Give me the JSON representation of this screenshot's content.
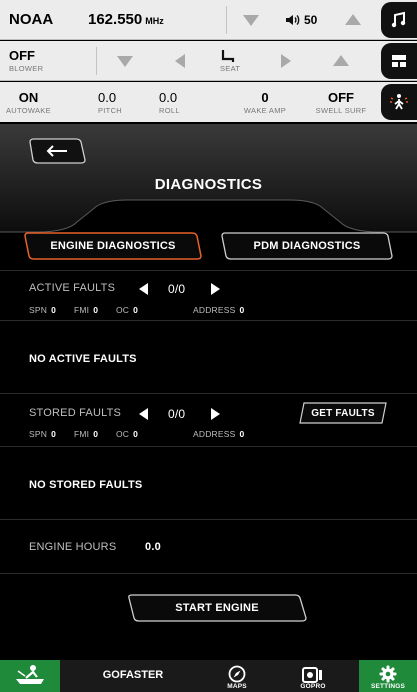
{
  "top_bar": {
    "radio_label": "NOAA",
    "frequency": "162.550",
    "frequency_unit": "MHz",
    "volume_icon": "🔉",
    "volume": "50"
  },
  "blower_row": {
    "blower_value": "OFF",
    "blower_label": "BLOWER",
    "seat_label": "SEAT"
  },
  "status_row": {
    "autowake_value": "ON",
    "autowake_label": "AUTOWAKE",
    "pitch_value": "0.0",
    "pitch_label": "PITCH",
    "roll_value": "0.0",
    "roll_label": "ROLL",
    "wake_amp_value": "0",
    "wake_amp_label": "WAKE AMP",
    "swell_surf_value": "OFF",
    "swell_surf_label": "SWELL SURF"
  },
  "page": {
    "title": "DIAGNOSTICS"
  },
  "tabs": {
    "engine": "ENGINE DIAGNOSTICS",
    "pdm": "PDM DIAGNOSTICS"
  },
  "active_faults": {
    "label": "ACTIVE FAULTS",
    "counter": "0/0",
    "spn_label": "SPN",
    "spn": "0",
    "fmi_label": "FMI",
    "fmi": "0",
    "oc_label": "OC",
    "oc": "0",
    "address_label": "ADDRESS",
    "address": "0",
    "message": "NO ACTIVE FAULTS"
  },
  "stored_faults": {
    "label": "STORED FAULTS",
    "counter": "0/0",
    "get_faults": "GET FAULTS",
    "spn_label": "SPN",
    "spn": "0",
    "fmi_label": "FMI",
    "fmi": "0",
    "oc_label": "OC",
    "oc": "0",
    "address_label": "ADDRESS",
    "address": "0",
    "message": "NO STORED FAULTS"
  },
  "engine_hours": {
    "label": "ENGINE HOURS",
    "value": "0.0"
  },
  "start_engine": "START ENGINE",
  "bottom_nav": {
    "gofaster": "GOFASTER",
    "maps": "MAPS",
    "gopro": "GOPRO",
    "settings": "SETTINGS"
  },
  "colors": {
    "accent_orange": "#e8602a",
    "active_nav_green": "#1e8a3a",
    "top_bar_bg": "#ececec"
  },
  "icons": [
    "music-note-icon",
    "layout-icon",
    "wake-person-icon",
    "back-arrow-icon",
    "seat-icon",
    "volume-icon",
    "boat-rider-icon",
    "maps-compass-icon",
    "camera-icon",
    "gear-icon"
  ]
}
